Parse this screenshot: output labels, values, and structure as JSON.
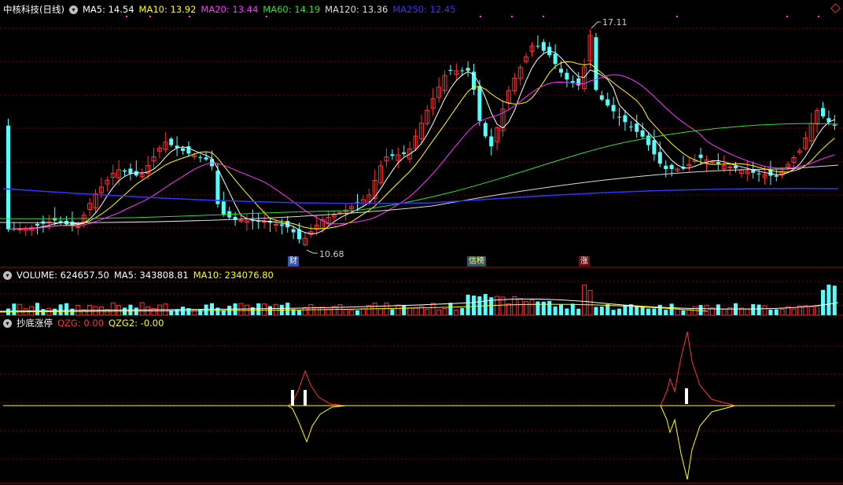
{
  "stock": {
    "title": "中核科技(日线)"
  },
  "ma_legend": [
    {
      "label": "MA5: 14.54",
      "color": "#ffffff"
    },
    {
      "label": "MA10: 13.92",
      "color": "#ffff00"
    },
    {
      "label": "MA20: 13.44",
      "color": "#ff33ff"
    },
    {
      "label": "MA60: 14.19",
      "color": "#33dd33"
    },
    {
      "label": "MA120: 13.36",
      "color": "#dddddd"
    },
    {
      "label": "MA250: 12.45",
      "color": "#3333ff"
    }
  ],
  "price_panel": {
    "high_label": "17.11",
    "low_label": "10.68",
    "event_tags": [
      {
        "text": "财",
        "bg": "#3355aa",
        "color": "#ffffff"
      },
      {
        "text": "信榜",
        "bg": "#335566",
        "color": "#ffff66"
      },
      {
        "text": "涨",
        "bg": "#661111",
        "color": "#ffffff"
      }
    ]
  },
  "volume_legend": [
    {
      "label": "VOLUME: 624657.50",
      "color": "#ffffff"
    },
    {
      "label": "MA5: 343808.81",
      "color": "#ffffff"
    },
    {
      "label": "MA10: 234076.80",
      "color": "#ffff00"
    }
  ],
  "indicator_legend": {
    "name": "抄底涨停",
    "items": [
      {
        "label": "QZG: 0.00",
        "color": "#ff3333"
      },
      {
        "label": "QZG2: -0.00",
        "color": "#ffff00"
      }
    ]
  },
  "colors": {
    "up": "#ff3333",
    "down": "#54ffff",
    "grid": "#7a0000",
    "axis": "#aa0000"
  }
}
